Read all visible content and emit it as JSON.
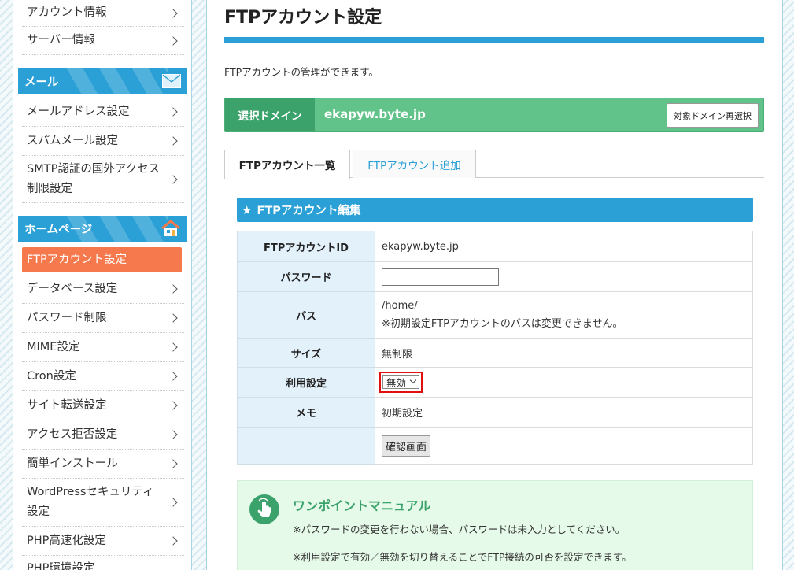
{
  "sidebar": {
    "account_items": [
      {
        "label": "アカウント情報"
      },
      {
        "label": "サーバー情報"
      }
    ],
    "mail_section": {
      "title": "メール"
    },
    "mail_items": [
      {
        "label": "メールアドレス設定"
      },
      {
        "label": "スパムメール設定"
      },
      {
        "label": "SMTP認証の国外アクセス制限設定"
      }
    ],
    "homepage_section": {
      "title": "ホームページ"
    },
    "homepage_items": [
      {
        "label": "FTPアカウント設定",
        "active": true
      },
      {
        "label": "データベース設定"
      },
      {
        "label": "パスワード制限"
      },
      {
        "label": "MIME設定"
      },
      {
        "label": "Cron設定"
      },
      {
        "label": "サイト転送設定"
      },
      {
        "label": "アクセス拒否設定"
      },
      {
        "label": "簡単インストール"
      },
      {
        "label": "WordPressセキュリティ設定"
      },
      {
        "label": "PHP高速化設定"
      },
      {
        "label": "PHP環境設定"
      }
    ]
  },
  "main": {
    "title": "FTPアカウント設定",
    "description": "FTPアカウントの管理ができます。",
    "domain": {
      "label": "選択ドメイン",
      "value": "ekapyw.byte.jp",
      "reselect_button": "対象ドメイン再選択"
    },
    "tabs": [
      {
        "label": "FTPアカウント一覧",
        "active": true
      },
      {
        "label": "FTPアカウント追加",
        "active": false
      }
    ],
    "edit": {
      "header": "FTPアカウント編集",
      "rows": {
        "ftp_id_label": "FTPアカウントID",
        "ftp_id_value": "ekapyw.byte.jp",
        "password_label": "パスワード",
        "password_value": "",
        "path_label": "パス",
        "path_value": "/home/",
        "path_note": "※初期設定FTPアカウントのパスは変更できません。",
        "size_label": "サイズ",
        "size_value": "無制限",
        "usage_label": "利用設定",
        "usage_value": "無効",
        "memo_label": "メモ",
        "memo_value": "初期設定"
      },
      "confirm_button": "確認画面"
    },
    "tip": {
      "title": "ワンポイントマニュアル",
      "lines": [
        "※パスワードの変更を行わない場合、パスワードは未入力としてください。",
        "※利用設定で有効／無効を切り替えることでFTP接続の可否を設定できます。"
      ]
    }
  },
  "colors": {
    "accent_blue": "#2aa0d6",
    "active_orange": "#f5794c",
    "domain_green": "#61c389",
    "tip_green": "#3aa26a",
    "highlight_red": "#e01010"
  }
}
